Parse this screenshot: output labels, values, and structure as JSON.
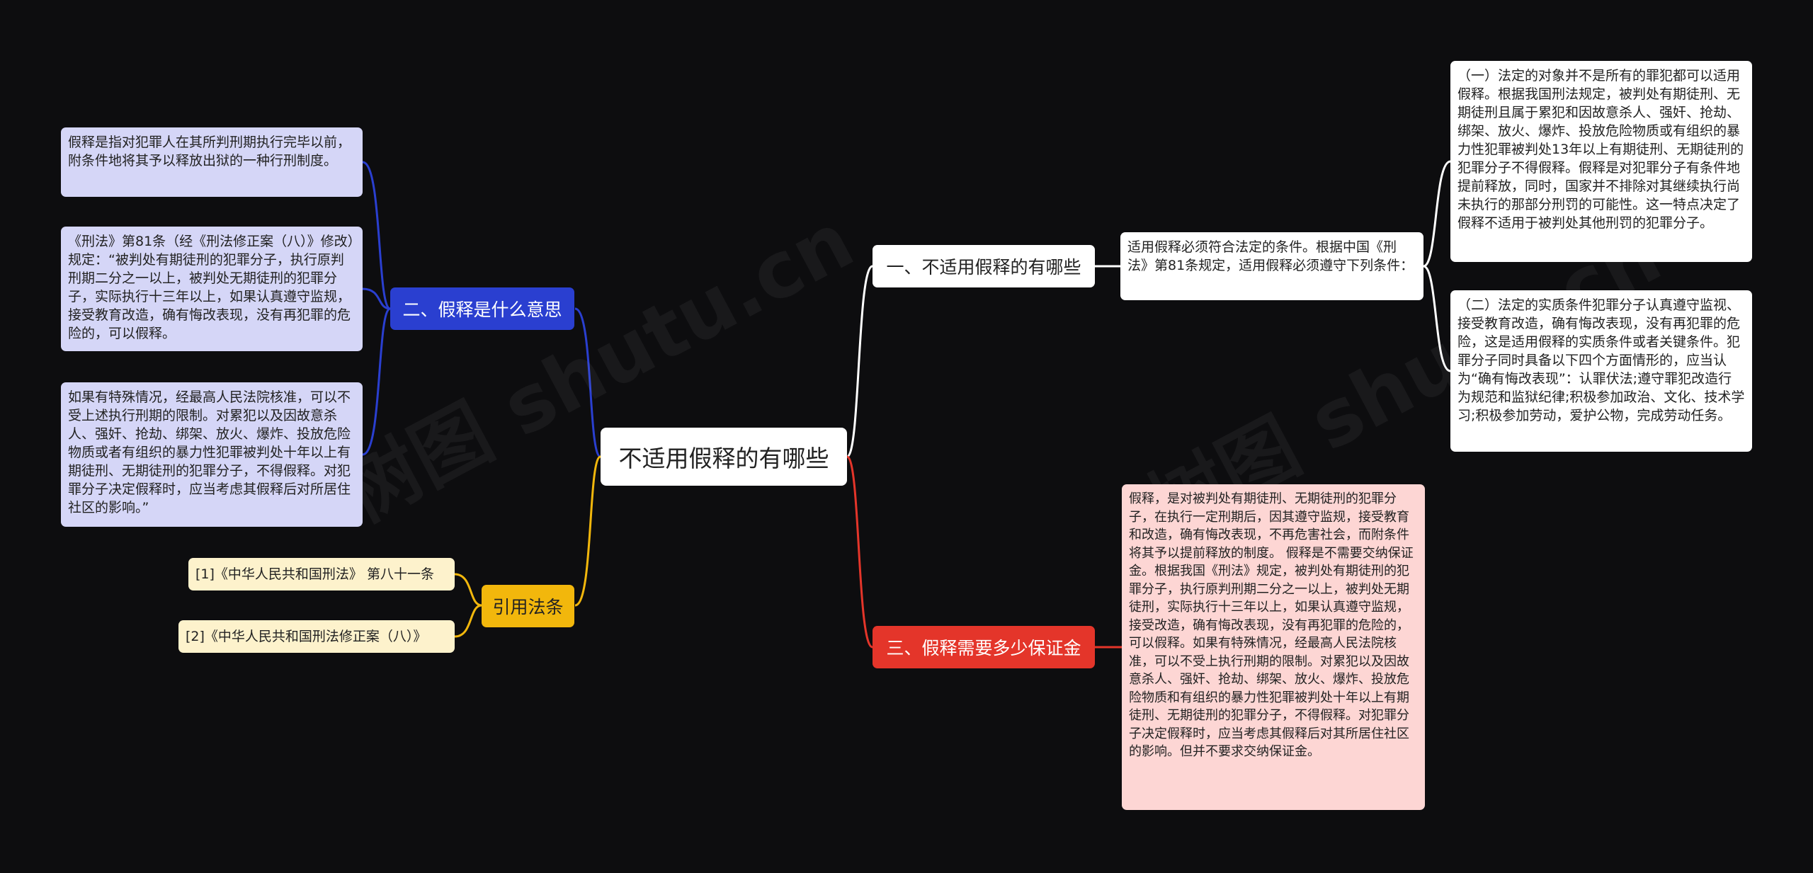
{
  "root": {
    "title": "不适用假释的有哪些"
  },
  "colors": {
    "background": "#0d0d0f",
    "blue": "#2a3fd0",
    "red": "#e4352a",
    "yellow": "#f2b70c",
    "white": "#ffffff"
  },
  "branches": {
    "b1": {
      "label": "一、不适用假释的有哪些",
      "intro": "适用假释必须符合法定的条件。根据中国《刑法》第81条规定，适用假释必须遵守下列条件：",
      "items": [
        "（一）法定的对象并不是所有的罪犯都可以适用假释。根据我国刑法规定，被判处有期徒刑、无期徒刑且属于累犯和因故意杀人、强奸、抢劫、绑架、放火、爆炸、投放危险物质或有组织的暴力性犯罪被判处13年以上有期徒刑、无期徒刑的犯罪分子不得假释。假释是对犯罪分子有条件地提前释放，同时，国家并不排除对其继续执行尚未执行的那部分刑罚的可能性。这一特点决定了假释不适用于被判处其他刑罚的犯罪分子。",
        "（二）法定的实质条件犯罪分子认真遵守监视、接受教育改造，确有悔改表现，没有再犯罪的危险，这是适用假释的实质条件或者关键条件。犯罪分子同时具备以下四个方面情形的，应当认为“确有悔改表现”：认罪伏法;遵守罪犯改造行为规范和监狱纪律;积极参加政治、文化、技术学习;积极参加劳动，爱护公物，完成劳动任务。"
      ]
    },
    "b2": {
      "label": "二、假释是什么意思",
      "items": [
        "假释是指对犯罪人在其所判刑期执行完毕以前，附条件地将其予以释放出狱的一种行刑制度。",
        "《刑法》第81条（经《刑法修正案（八）》修改）规定：“被判处有期徒刑的犯罪分子，执行原判刑期二分之一以上，被判处无期徒刑的犯罪分子，实际执行十三年以上，如果认真遵守监规，接受教育改造，确有悔改表现，没有再犯罪的危险的，可以假释。",
        "如果有特殊情况，经最高人民法院核准，可以不受上述执行刑期的限制。对累犯以及因故意杀人、强奸、抢劫、绑架、放火、爆炸、投放危险物质或者有组织的暴力性犯罪被判处十年以上有期徒刑、无期徒刑的犯罪分子，不得假释。对犯罪分子决定假释时，应当考虑其假释后对所居住社区的影响。”"
      ]
    },
    "b3": {
      "label": "三、假释需要多少保证金",
      "content": "假释，是对被判处有期徒刑、无期徒刑的犯罪分子，在执行一定刑期后，因其遵守监规，接受教育和改造，确有悔改表现，不再危害社会，而附条件将其予以提前释放的制度。 假释是不需要交纳保证金。根据我国《刑法》规定，被判处有期徒刑的犯罪分子，执行原判刑期二分之一以上，被判处无期徒刑，实际执行十三年以上，如果认真遵守监规，接受改造，确有悔改表现，没有再犯罪的危险的，可以假释。如果有特殊情况，经最高人民法院核准，可以不受上执行刑期的限制。对累犯以及因故意杀人、强奸、抢劫、绑架、放火、爆炸、投放危险物质和有组织的暴力性犯罪被判处十年以上有期徒刑、无期徒刑的犯罪分子，不得假释。对犯罪分子决定假释时，应当考虑其假释后对其所居住社区的影响。但并不要求交纳保证金。"
    },
    "b4": {
      "label": "引用法条",
      "items": [
        "[1]《中华人民共和国刑法》 第八十一条",
        "[2]《中华人民共和国刑法修正案（八）》"
      ]
    }
  },
  "watermarks": [
    "树图 shutu.cn",
    "树图 shutu.cn"
  ]
}
